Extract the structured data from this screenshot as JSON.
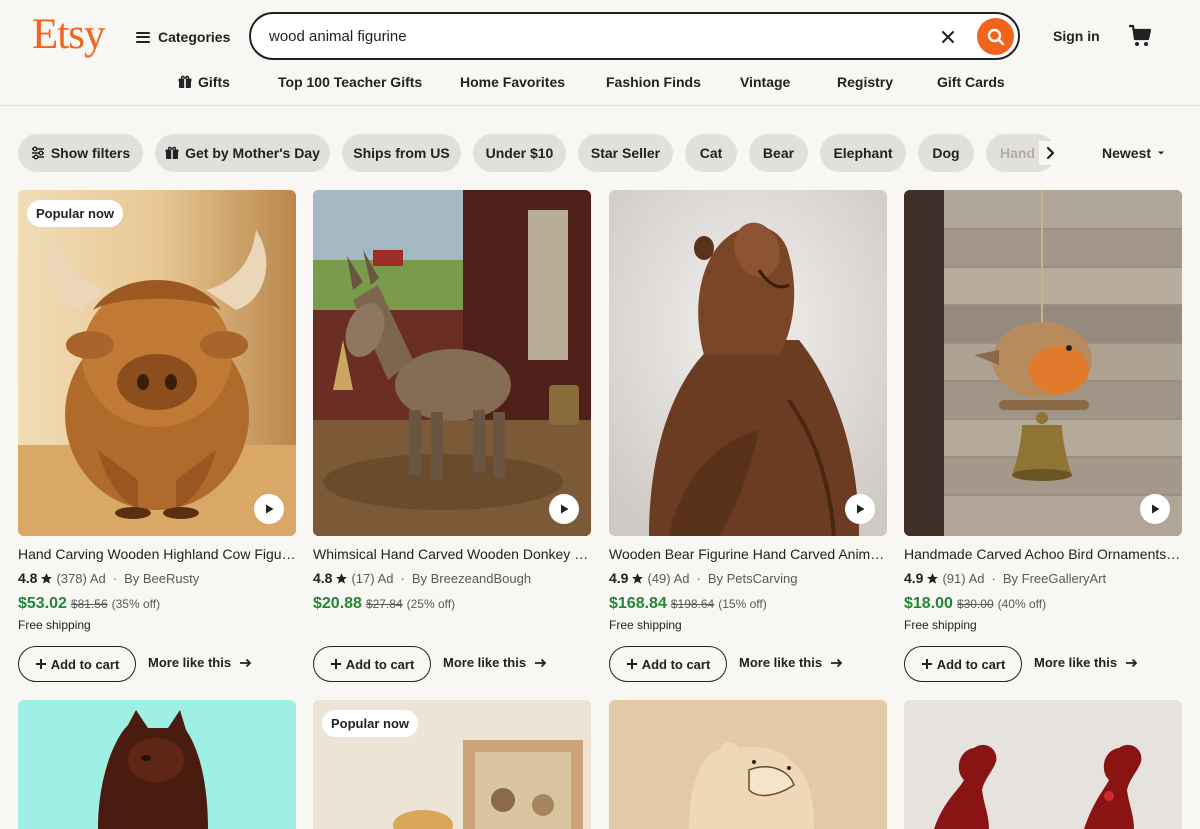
{
  "header": {
    "logo": "Etsy",
    "categories_label": "Categories",
    "search_value": "wood animal figurine",
    "sign_in": "Sign in"
  },
  "subnav": [
    "Gifts",
    "Top 100 Teacher Gifts",
    "Home Favorites",
    "Fashion Finds",
    "Vintage",
    "Registry",
    "Gift Cards"
  ],
  "filters": {
    "show_filters": "Show filters",
    "chips": [
      "Get by Mother's Day",
      "Ships from US",
      "Under $10",
      "Star Seller",
      "Cat",
      "Bear",
      "Elephant",
      "Dog",
      "Hand C"
    ],
    "sort": "Newest"
  },
  "products": [
    {
      "badge": "Popular now",
      "title": "Hand Carving Wooden Highland Cow Figurine",
      "rating": "4.8",
      "reviews": "(378)",
      "ad": "Ad",
      "shop": "By BeeRusty",
      "price": "$53.02",
      "old_price": "$81.56",
      "discount": "(35% off)",
      "shipping": "Free shipping",
      "add_to_cart": "Add to cart",
      "more_like": "More like this"
    },
    {
      "badge": "",
      "title": "Whimsical Hand Carved Wooden Donkey Figurine",
      "rating": "4.8",
      "reviews": "(17)",
      "ad": "Ad",
      "shop": "By BreezeandBough",
      "price": "$20.88",
      "old_price": "$27.84",
      "discount": "(25% off)",
      "shipping": "",
      "add_to_cart": "Add to cart",
      "more_like": "More like this"
    },
    {
      "badge": "",
      "title": "Wooden Bear Figurine Hand Carved Animal Sculpture",
      "rating": "4.9",
      "reviews": "(49)",
      "ad": "Ad",
      "shop": "By PetsCarving",
      "price": "$168.84",
      "old_price": "$198.64",
      "discount": "(15% off)",
      "shipping": "Free shipping",
      "add_to_cart": "Add to cart",
      "more_like": "More like this"
    },
    {
      "badge": "",
      "title": "Handmade Carved Achoo Bird Ornaments, Wooden Robin",
      "rating": "4.9",
      "reviews": "(91)",
      "ad": "Ad",
      "shop": "By FreeGalleryArt",
      "price": "$18.00",
      "old_price": "$30.00",
      "discount": "(40% off)",
      "shipping": "Free shipping",
      "add_to_cart": "Add to cart",
      "more_like": "More like this"
    }
  ],
  "row2_badges": [
    "",
    "Popular now",
    "",
    ""
  ],
  "colors": {
    "brand": "#f1641e",
    "price_green": "#258635",
    "chip_bg": "#e2e0dc",
    "page_bg": "#f8f7f4"
  }
}
